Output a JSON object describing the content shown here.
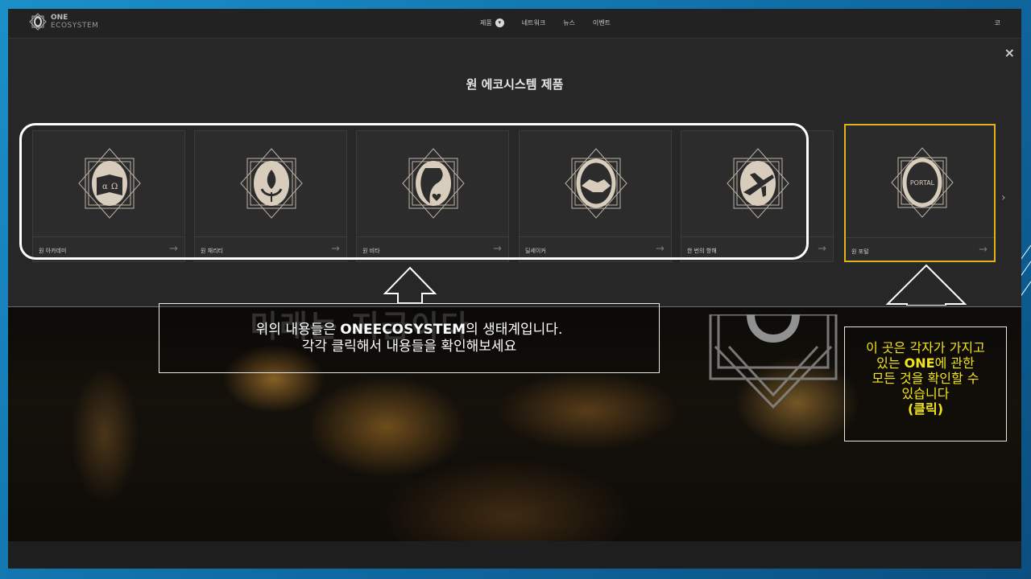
{
  "nav": {
    "brand_line1": "ONE",
    "brand_line2": "ECOSYSTEM",
    "items": [
      "제품",
      "네트워크",
      "뉴스",
      "이벤트"
    ],
    "lang": "코"
  },
  "panel": {
    "title": "원 에코시스템 제품",
    "close_icon": "×",
    "next_icon": "›",
    "cards": [
      {
        "label": "원 아카데미",
        "icon": "alpha-omega-book-icon"
      },
      {
        "label": "원 채리티",
        "icon": "lotus-hands-icon"
      },
      {
        "label": "원 비타",
        "icon": "woman-profile-icon"
      },
      {
        "label": "딜세이커",
        "icon": "handshake-icon"
      },
      {
        "label": "한 번의 항해",
        "icon": "airplane-icon"
      },
      {
        "label": "원 포털",
        "icon": "portal-icon",
        "emblem_text": "PORTAL"
      }
    ],
    "arrow": "→"
  },
  "background": {
    "headline": "미래는 지금이다"
  },
  "annotations": {
    "left_line1_prefix": "위의 내용들은 ",
    "left_line1_bold": "ONEECOSYSTEM",
    "left_line1_suffix": "의 생태계입니다.",
    "left_line2": "각각 클릭해서 내용들을 확인해보세요",
    "right_line1": "이 곳은 각자가 가지고",
    "right_line2_prefix": "있는 ",
    "right_line2_bold": "ONE",
    "right_line2_suffix": "에 관한",
    "right_line3": "모든 것을 확인할 수",
    "right_line4": "있습니다",
    "right_line5": "(클릭)"
  },
  "colors": {
    "highlight": "#e3b21c",
    "callout_text_right": "#f1e51a",
    "slide_bg": "#1b8fc9"
  }
}
